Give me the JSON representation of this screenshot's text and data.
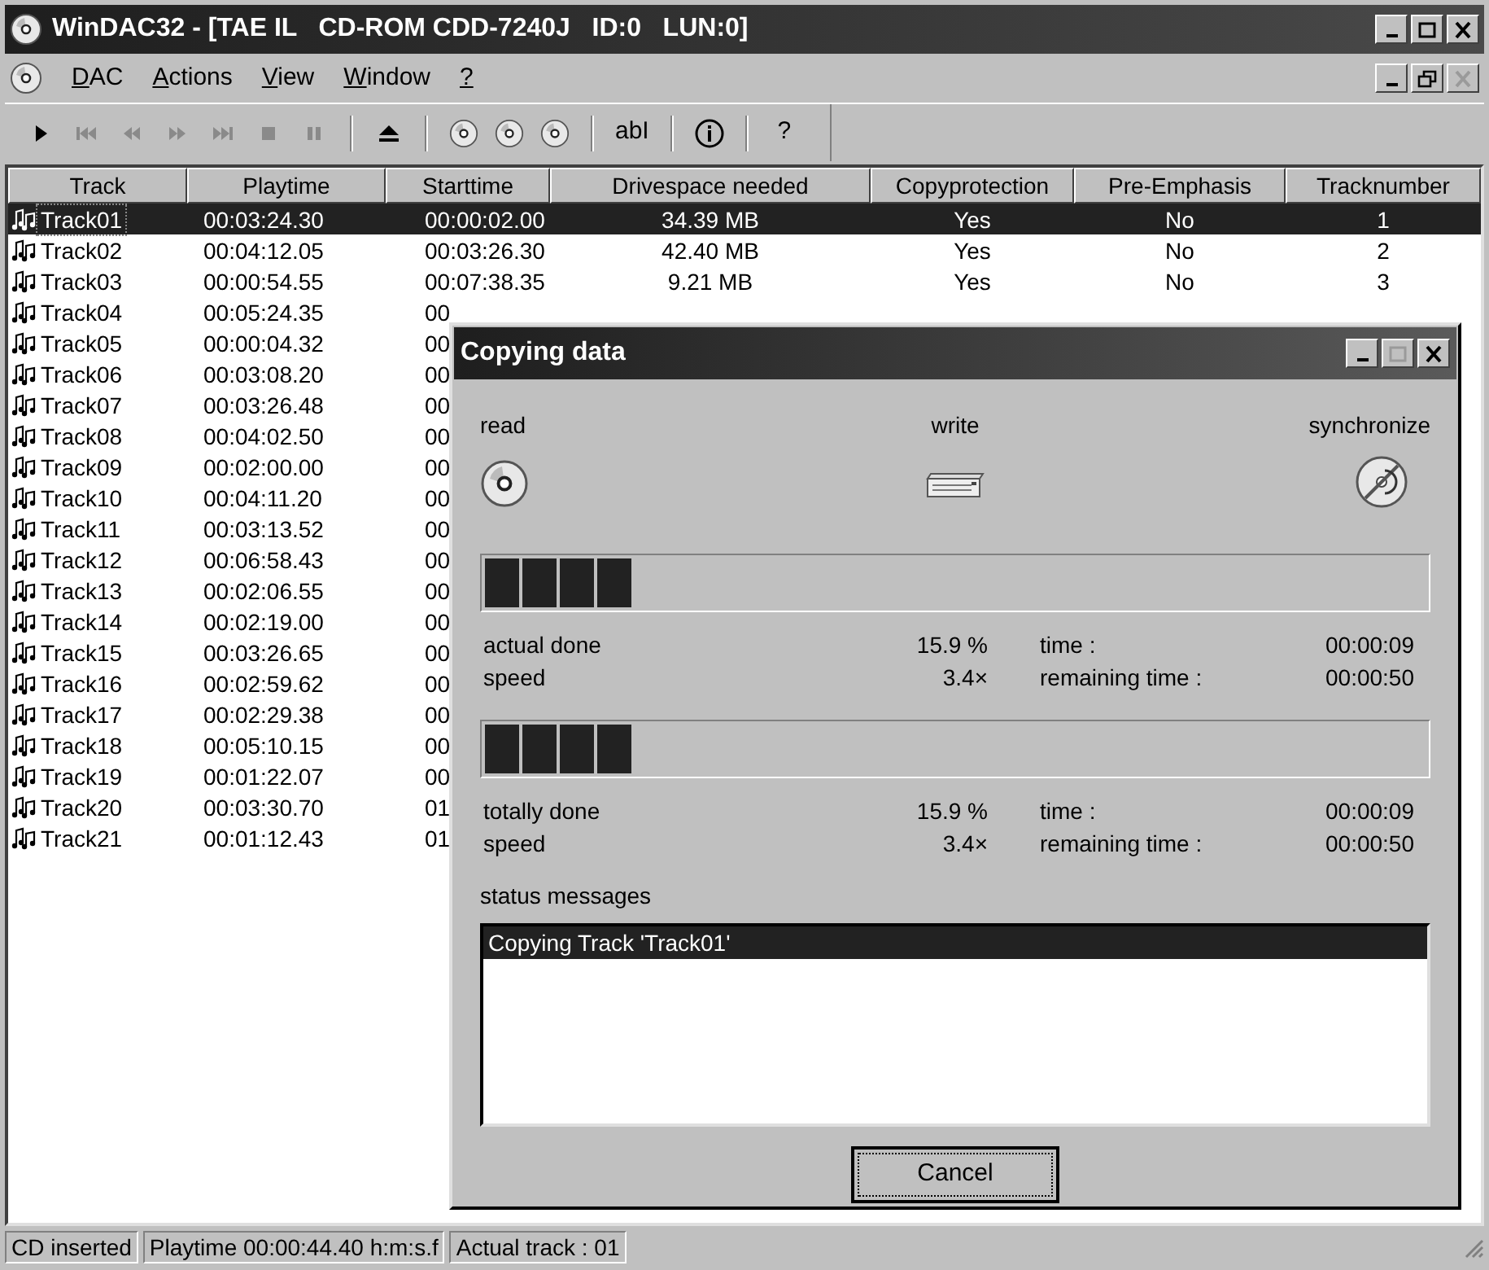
{
  "window": {
    "title": "WinDAC32 - [TAE IL   CD-ROM CDD-7240J   ID:0   LUN:0]"
  },
  "menu": [
    {
      "label": "DAC"
    },
    {
      "label": "Actions"
    },
    {
      "label": "View"
    },
    {
      "label": "Window"
    },
    {
      "label": "?"
    }
  ],
  "toolbar": [
    {
      "kind": "play",
      "disabled": false
    },
    {
      "kind": "first",
      "disabled": true
    },
    {
      "kind": "rewind",
      "disabled": true
    },
    {
      "kind": "forward",
      "disabled": true
    },
    {
      "kind": "last",
      "disabled": true
    },
    {
      "kind": "stop",
      "disabled": true
    },
    {
      "kind": "pause",
      "disabled": true
    },
    {
      "kind": "separator"
    },
    {
      "kind": "eject",
      "disabled": false
    },
    {
      "kind": "separator"
    },
    {
      "kind": "cd",
      "disabled": false
    },
    {
      "kind": "cd",
      "disabled": false
    },
    {
      "kind": "cd",
      "disabled": false
    },
    {
      "kind": "separator"
    },
    {
      "kind": "text",
      "label": "abI",
      "disabled": false
    },
    {
      "kind": "separator"
    },
    {
      "kind": "info",
      "disabled": false
    },
    {
      "kind": "separator"
    },
    {
      "kind": "text",
      "label": "?",
      "disabled": false
    }
  ],
  "table": {
    "columns": [
      "Track",
      "Playtime",
      "Starttime",
      "Drivespace needed",
      "Copyprotection",
      "Pre-Emphasis",
      "Tracknumber"
    ],
    "rows": [
      {
        "selected": true,
        "cells": [
          "Track01",
          "00:03:24.30",
          "00:00:02.00",
          "34.39 MB",
          "Yes",
          "No",
          "1"
        ]
      },
      {
        "selected": false,
        "cells": [
          "Track02",
          "00:04:12.05",
          "00:03:26.30",
          "42.40 MB",
          "Yes",
          "No",
          "2"
        ]
      },
      {
        "selected": false,
        "cells": [
          "Track03",
          "00:00:54.55",
          "00:07:38.35",
          "9.21 MB",
          "Yes",
          "No",
          "3"
        ]
      },
      {
        "selected": false,
        "cells": [
          "Track04",
          "00:05:24.35",
          "00"
        ]
      },
      {
        "selected": false,
        "cells": [
          "Track05",
          "00:00:04.32",
          "00"
        ]
      },
      {
        "selected": false,
        "cells": [
          "Track06",
          "00:03:08.20",
          "00"
        ]
      },
      {
        "selected": false,
        "cells": [
          "Track07",
          "00:03:26.48",
          "00"
        ]
      },
      {
        "selected": false,
        "cells": [
          "Track08",
          "00:04:02.50",
          "00"
        ]
      },
      {
        "selected": false,
        "cells": [
          "Track09",
          "00:02:00.00",
          "00"
        ]
      },
      {
        "selected": false,
        "cells": [
          "Track10",
          "00:04:11.20",
          "00"
        ]
      },
      {
        "selected": false,
        "cells": [
          "Track11",
          "00:03:13.52",
          "00"
        ]
      },
      {
        "selected": false,
        "cells": [
          "Track12",
          "00:06:58.43",
          "00"
        ]
      },
      {
        "selected": false,
        "cells": [
          "Track13",
          "00:02:06.55",
          "00"
        ]
      },
      {
        "selected": false,
        "cells": [
          "Track14",
          "00:02:19.00",
          "00"
        ]
      },
      {
        "selected": false,
        "cells": [
          "Track15",
          "00:03:26.65",
          "00"
        ]
      },
      {
        "selected": false,
        "cells": [
          "Track16",
          "00:02:59.62",
          "00"
        ]
      },
      {
        "selected": false,
        "cells": [
          "Track17",
          "00:02:29.38",
          "00"
        ]
      },
      {
        "selected": false,
        "cells": [
          "Track18",
          "00:05:10.15",
          "00"
        ]
      },
      {
        "selected": false,
        "cells": [
          "Track19",
          "00:01:22.07",
          "00"
        ]
      },
      {
        "selected": false,
        "cells": [
          "Track20",
          "00:03:30.70",
          "01"
        ]
      },
      {
        "selected": false,
        "cells": [
          "Track21",
          "00:01:12.43",
          "01"
        ]
      }
    ]
  },
  "dialog": {
    "title": "Copying data",
    "devices": [
      {
        "kind": "read",
        "label": "read"
      },
      {
        "kind": "write",
        "label": "write"
      },
      {
        "kind": "sync",
        "label": "synchronize"
      }
    ],
    "sections": [
      {
        "level": 0.159,
        "rows": [
          {
            "label": "actual done",
            "value": "15.9 %",
            "key": "time :",
            "key_value": "00:00:09"
          },
          {
            "label": "speed",
            "value": "3.4×",
            "key": "remaining time :",
            "key_value": "00:00:50"
          }
        ]
      },
      {
        "level": 0.159,
        "rows": [
          {
            "label": "totally done",
            "value": "15.9 %",
            "key": "time :",
            "key_value": "00:00:09"
          },
          {
            "label": "speed",
            "value": "3.4×",
            "key": "remaining time :",
            "key_value": "00:00:50"
          }
        ]
      }
    ],
    "status_label": "status messages",
    "messages": [
      {
        "text": "Copying Track 'Track01'",
        "selected": true
      }
    ],
    "button": "Cancel"
  },
  "status_bar": [
    "CD inserted",
    "Playtime 00:00:44.40 h:m:s.f",
    "Actual track : 01"
  ]
}
